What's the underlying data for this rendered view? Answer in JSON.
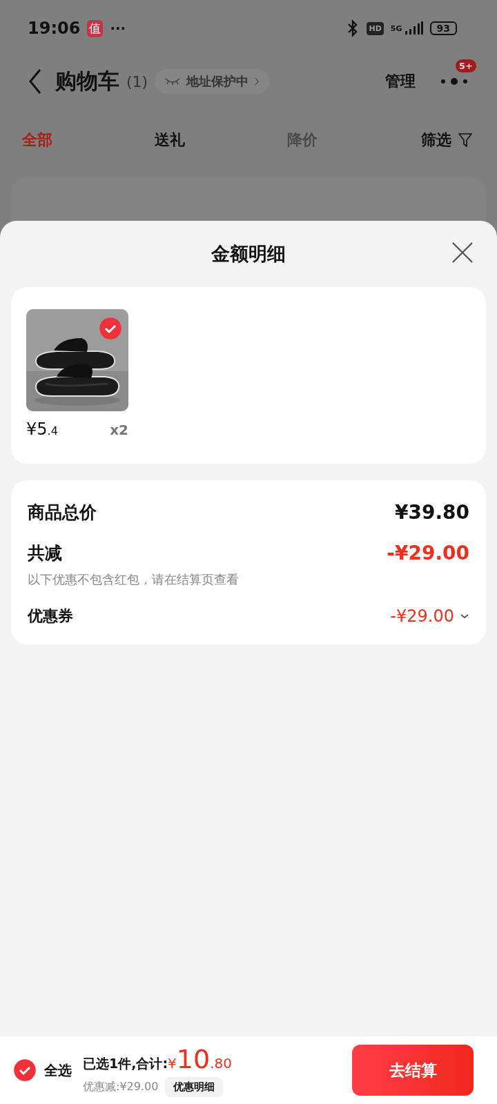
{
  "status_bar": {
    "time": "19:06",
    "app_badge": "值",
    "more": "···",
    "hd": "HD",
    "network": "5G",
    "battery": "93"
  },
  "header": {
    "title": "购物车",
    "count": "(1)",
    "address_badge": "地址保护中",
    "manage": "管理",
    "notification_badge": "5+"
  },
  "tabs": [
    {
      "label": "全部",
      "selected": true,
      "disabled": false
    },
    {
      "label": "送礼",
      "selected": false,
      "disabled": false
    },
    {
      "label": "降价",
      "selected": false,
      "disabled": true
    }
  ],
  "filter": {
    "label": "筛选"
  },
  "sheet": {
    "title": "金额明细",
    "items": [
      {
        "kind": "picture",
        "checked": true,
        "price_main": "¥5",
        "price_decimal": ".4",
        "quantity": "x2"
      }
    ],
    "rows": [
      {
        "kind": "total",
        "label": "商品总价",
        "value": "¥39.80"
      },
      {
        "kind": "discount",
        "label": "共减",
        "value": "-¥29.00",
        "note": "以下优惠不包含红包，请在结算页查看"
      },
      {
        "kind": "coupon",
        "label": "优惠券",
        "value": "-¥29.00",
        "expanded": false
      }
    ]
  },
  "footer": {
    "select_all": {
      "label": "全选",
      "checked": true
    },
    "selected_text": "已选1件,合计:",
    "currency": "¥",
    "total_int": "10",
    "total_dec": ".80",
    "discount_text": "优惠减:¥29.00",
    "detail_button": "优惠明细",
    "checkout": "去结算"
  }
}
